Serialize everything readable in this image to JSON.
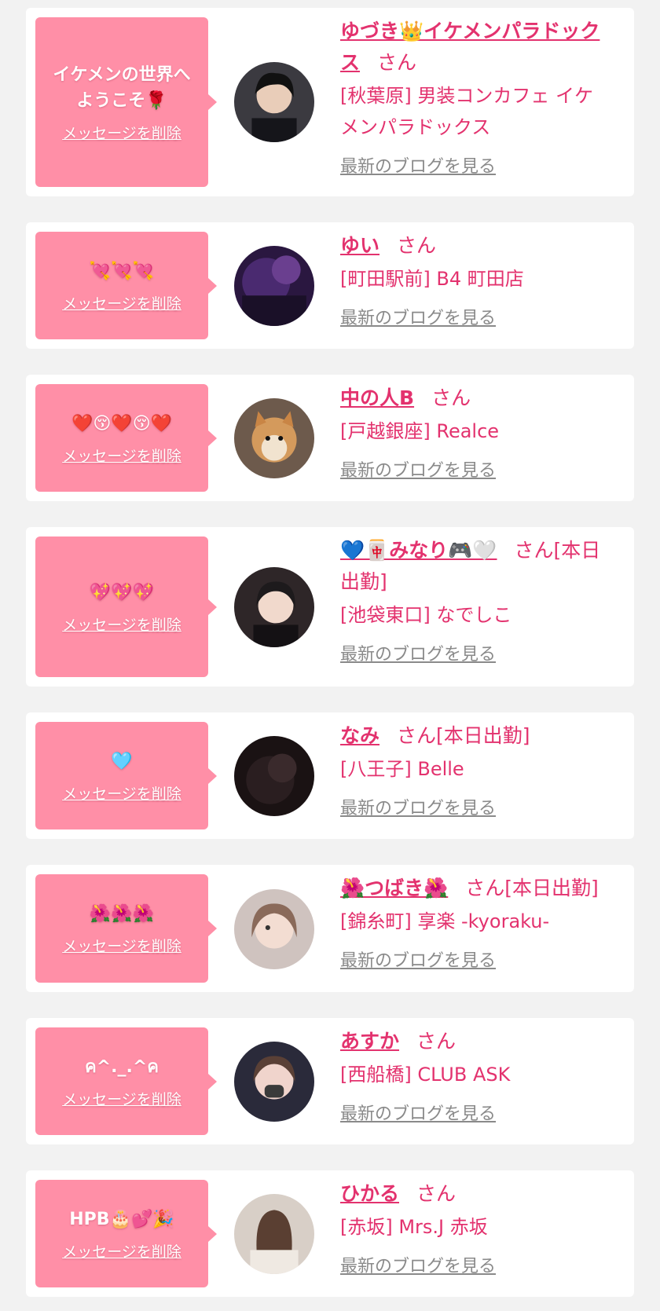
{
  "common": {
    "delete_label": "メッセージを削除",
    "blog_label": "最新のブログを見る",
    "honorific": "さん"
  },
  "colors": {
    "bubble": "#ff8fa7",
    "accent": "#e3326e",
    "link_gray": "#8a8a8a",
    "background": "#f2f2f2"
  },
  "items": [
    {
      "message_line1": "イケメンの世界へ",
      "message_line2": "ようこそ🌹",
      "name": "ゆづき👑イケメンパラドックス",
      "suffix": "",
      "shop": "[秋葉原] 男装コンカフェ イケメンパラドックス"
    },
    {
      "message_line1": "💘💘💘",
      "message_line2": "",
      "name": "ゆい",
      "suffix": "",
      "shop": "[町田駅前] B4 町田店"
    },
    {
      "message_line1": "❤️😚❤️😚❤️",
      "message_line2": "",
      "name": "中の人B",
      "suffix": "",
      "shop": "[戸越銀座] Realce"
    },
    {
      "message_line1": "💖💖💖",
      "message_line2": "",
      "name": "💙🀄みなり🎮🤍",
      "suffix": "[本日出勤]",
      "shop": "[池袋東口] なでしこ"
    },
    {
      "message_line1": "🩵",
      "message_line2": "",
      "name": "なみ",
      "suffix": "[本日出勤]",
      "shop": "[八王子] Belle"
    },
    {
      "message_line1": "🌺🌺🌺",
      "message_line2": "",
      "name": "🌺つばき🌺",
      "suffix": "[本日出勤]",
      "shop": "[錦糸町] 享楽 -kyoraku-"
    },
    {
      "message_line1": "ค^._.^ค",
      "message_line2": "",
      "name": "あすか",
      "suffix": "",
      "shop": "[西船橋] CLUB ASK"
    },
    {
      "message_line1": "HPB🎂💕🎉",
      "message_line2": "",
      "name": "ひかる",
      "suffix": "",
      "shop": "[赤坂] Mrs.J 赤坂"
    }
  ]
}
